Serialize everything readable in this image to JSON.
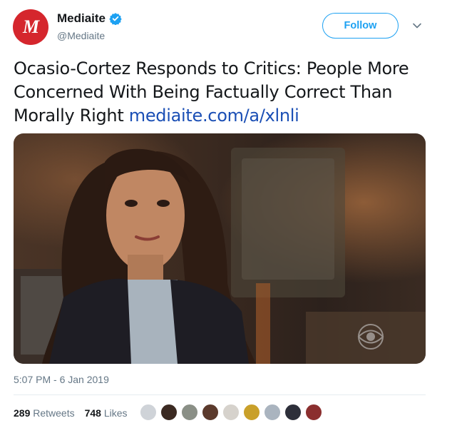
{
  "account": {
    "avatar_letter": "M",
    "display_name": "Mediaite",
    "handle": "@Mediaite",
    "verified": true
  },
  "actions": {
    "follow_label": "Follow"
  },
  "tweet": {
    "text": "Ocasio-Cortez Responds to Critics: People More Concerned With Being Factually Correct Than Morally Right ",
    "link": "mediaite.com/a/xlnli",
    "timestamp": "5:07 PM - 6 Jan 2019"
  },
  "stats": {
    "retweets_count": "289",
    "retweets_label": "Retweets",
    "likes_count": "748",
    "likes_label": "Likes"
  },
  "likers": [
    {
      "color": "#cfd3d8"
    },
    {
      "color": "#3b2a22"
    },
    {
      "color": "#8a8f86"
    },
    {
      "color": "#5b3a2c"
    },
    {
      "color": "#d6d2cc"
    },
    {
      "color": "#c9a02a"
    },
    {
      "color": "#aab4bf"
    },
    {
      "color": "#2d2f3a"
    },
    {
      "color": "#8b2f2f"
    }
  ],
  "colors": {
    "brand_red": "#d5262d",
    "twitter_blue": "#1da1f2",
    "link_blue": "#1b4fb5"
  }
}
